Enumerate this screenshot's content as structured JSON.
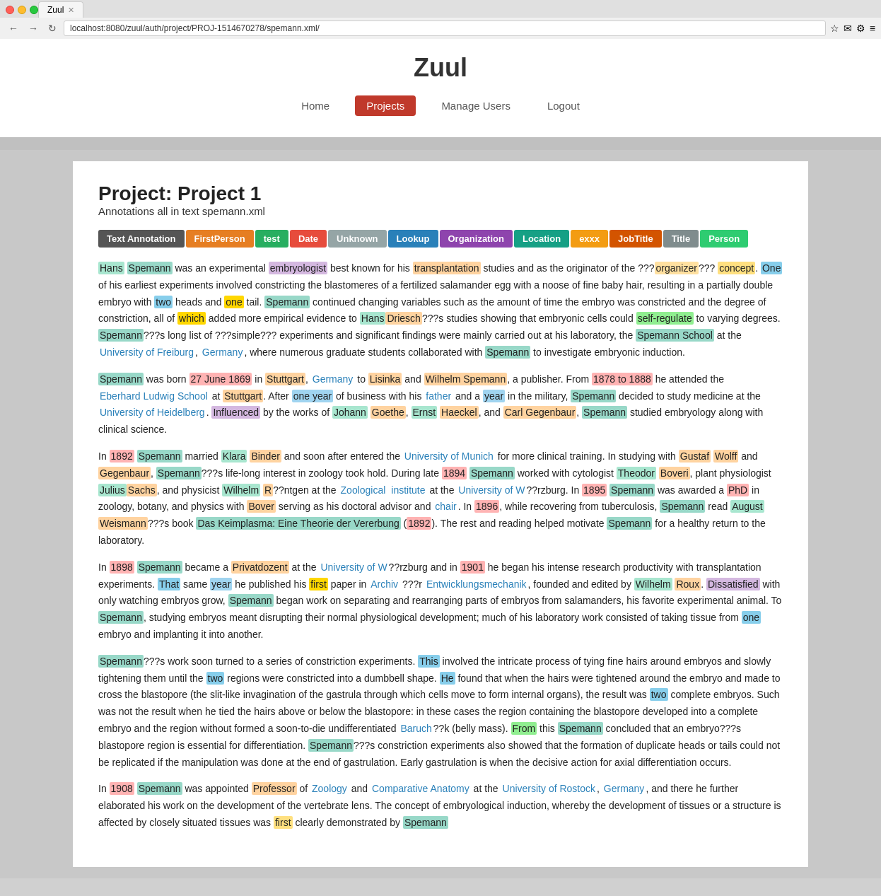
{
  "browser": {
    "tab_title": "Zuul",
    "url": "localhost:8080/zuul/auth/project/PROJ-1514670278/spemann.xml/"
  },
  "nav": {
    "home": "Home",
    "projects": "Projects",
    "manage_users": "Manage Users",
    "logout": "Logout"
  },
  "site": {
    "title": "Zuul"
  },
  "page": {
    "title": "Project: Project 1",
    "subtitle": "Annotations all in text spemann.xml"
  },
  "tags": [
    {
      "label": "Text Annotation",
      "class": "tag-text-annotation"
    },
    {
      "label": "FirstPerson",
      "class": "tag-first-person"
    },
    {
      "label": "test",
      "class": "tag-test"
    },
    {
      "label": "Date",
      "class": "tag-date"
    },
    {
      "label": "Unknown",
      "class": "tag-unknown"
    },
    {
      "label": "Lookup",
      "class": "tag-lookup"
    },
    {
      "label": "Organization",
      "class": "tag-organization"
    },
    {
      "label": "Location",
      "class": "tag-location"
    },
    {
      "label": "exxx",
      "class": "tag-exxx"
    },
    {
      "label": "JobTitle",
      "class": "tag-jobtitle"
    },
    {
      "label": "Title",
      "class": "tag-title"
    },
    {
      "label": "Person",
      "class": "tag-person"
    }
  ]
}
